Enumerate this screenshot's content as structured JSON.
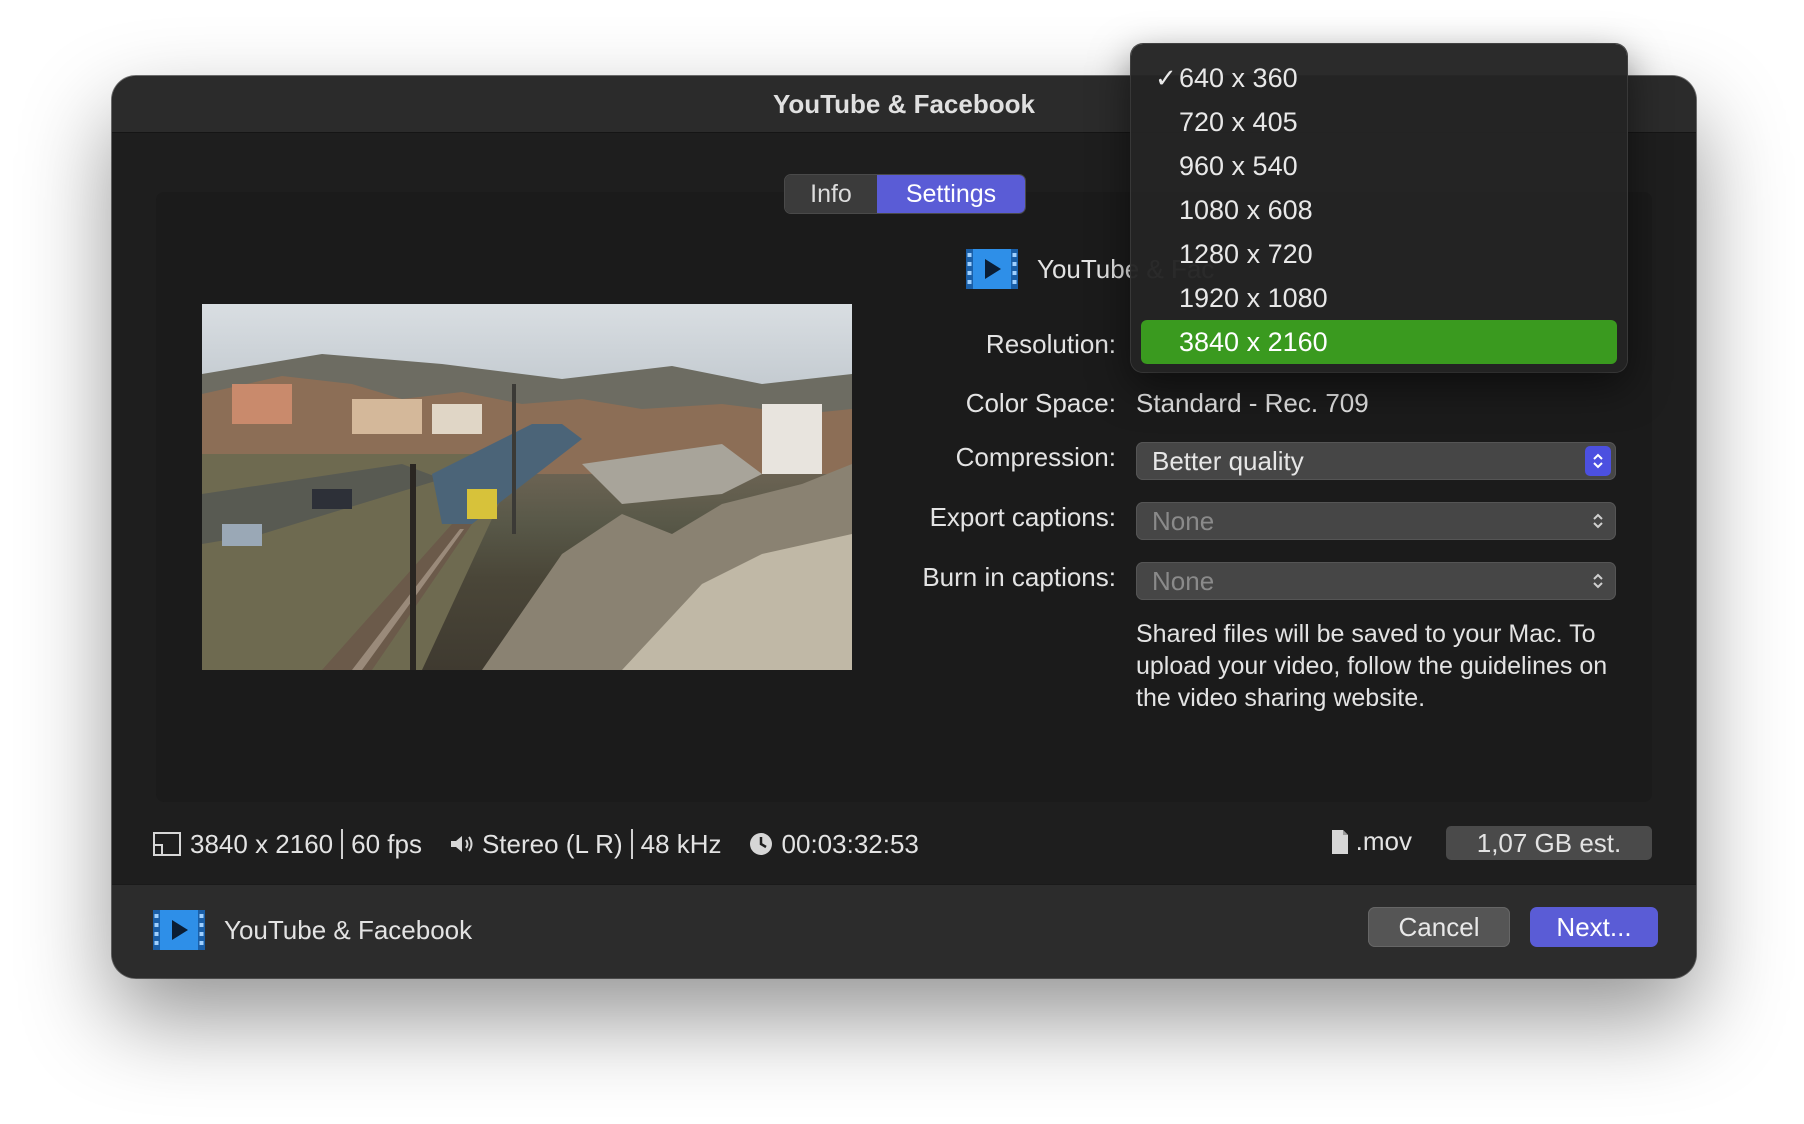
{
  "window": {
    "title": "YouTube & Facebook"
  },
  "tabs": [
    {
      "label": "Info",
      "active": false
    },
    {
      "label": "Settings",
      "active": true
    }
  ],
  "preset": {
    "name": "YouTube & Fac",
    "icon": "video-play-icon"
  },
  "fields": {
    "resolution": {
      "label": "Resolution:"
    },
    "color_space": {
      "label": "Color Space:",
      "value": "Standard - Rec. 709"
    },
    "compression": {
      "label": "Compression:",
      "value": "Better quality"
    },
    "export_captions": {
      "label": "Export captions:",
      "value": "None"
    },
    "burn_captions": {
      "label": "Burn in captions:",
      "value": "None"
    }
  },
  "note": "Shared files will be saved to your Mac. To upload your video, follow the guidelines on the video sharing website.",
  "status": {
    "resolution": "3840 x 2160",
    "fps": "60 fps",
    "audio": "Stereo (L R)",
    "sample_rate": "48 kHz",
    "duration": "00:03:32:53",
    "file_type": ".mov",
    "size_estimate": "1,07 GB est."
  },
  "bottom": {
    "preset_label": "YouTube & Facebook",
    "cancel_label": "Cancel",
    "next_label": "Next..."
  },
  "resolution_menu": {
    "options": [
      "640 x 360",
      "720 x 405",
      "960 x 540",
      "1080 x 608",
      "1280 x 720",
      "1920 x 1080",
      "3840 x 2160"
    ],
    "checked_index": 0,
    "highlighted_index": 6,
    "check_glyph": "✓"
  },
  "colors": {
    "accent": "#5a5cd6",
    "highlight": "#3a9a1f",
    "icon_blue": "#2e8fe8"
  }
}
